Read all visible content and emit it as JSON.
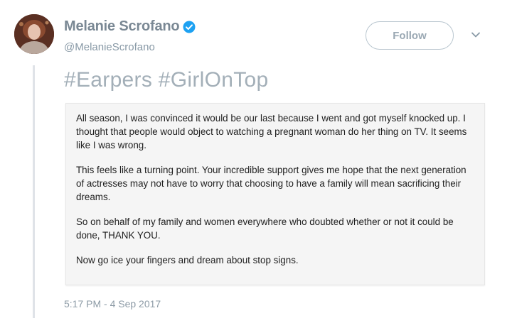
{
  "tweet": {
    "display_name": "Melanie Scrofano",
    "handle": "@MelanieScrofano",
    "verified": true,
    "follow_label": "Follow",
    "hashtags": "#Earpers #GirlOnTop",
    "note_paragraphs": [
      "All season, I was convinced it would be our last because I went and got myself knocked up. I thought that people would object to watching a pregnant woman do her thing on TV. It seems like I was wrong.",
      "This feels like a turning point. Your incredible support gives me hope that the next generation of actresses may not have to worry that choosing to have a family will mean sacrificing their dreams.",
      "So on behalf of my family and women everywhere who doubted whether or not it could be done, THANK YOU.",
      "Now go ice your fingers and dream about stop signs."
    ],
    "timestamp": "5:17 PM - 4 Sep 2017"
  },
  "icons": {
    "verified": "verified-badge-icon",
    "menu": "chevron-down-icon"
  },
  "colors": {
    "verified_blue": "#1da1f2",
    "muted_text": "#8899a6",
    "note_background": "#f5f5f5"
  }
}
